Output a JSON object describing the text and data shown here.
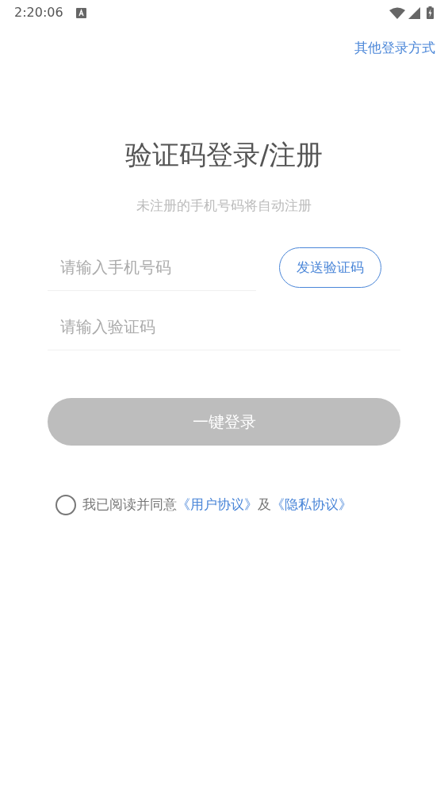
{
  "status_bar": {
    "time": "2:20:06"
  },
  "other_login": "其他登录方式",
  "title": "验证码登录/注册",
  "subtitle": "未注册的手机号码将自动注册",
  "phone_field": {
    "placeholder": "请输入手机号码"
  },
  "send_code_button": "发送验证码",
  "code_field": {
    "placeholder": "请输入验证码"
  },
  "login_button": {
    "label": "一键登录",
    "disabled": true
  },
  "agreement": {
    "checked": false,
    "parts": [
      {
        "kind": "text",
        "text": "我已阅读并同意"
      },
      {
        "kind": "link",
        "text": "《用户协议》"
      },
      {
        "kind": "text",
        "text": "及"
      },
      {
        "kind": "link",
        "text": "《隐私协议》"
      }
    ]
  }
}
